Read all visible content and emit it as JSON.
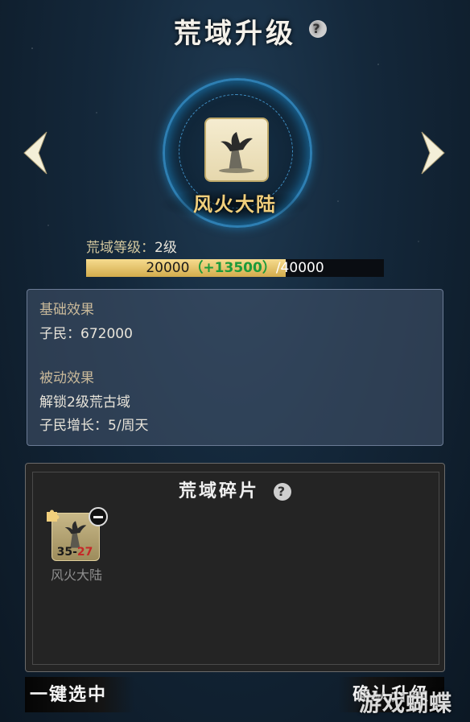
{
  "header": {
    "title": "荒域升级"
  },
  "domain": {
    "name": "风火大陆"
  },
  "level": {
    "label": "荒域等级：",
    "value": "2级"
  },
  "progress": {
    "current": "20000",
    "bonus": "（+13500）",
    "max": "/40000",
    "fill_fraction": 0.67
  },
  "effects": {
    "basic_title": "基础效果",
    "basic_lines": [
      "子民：672000"
    ],
    "passive_title": "被动效果",
    "passive_lines": [
      "解锁2级荒古域",
      "子民增长：5/周天"
    ]
  },
  "fragments": {
    "title": "荒域碎片",
    "items": [
      {
        "name": "风火大陆",
        "count_left": "35",
        "sep": "-",
        "count_right": "27"
      }
    ]
  },
  "buttons": {
    "select_all": "一键选中",
    "confirm": "确认升级"
  },
  "help_glyph": "?",
  "watermark": "游戏蝴蝶",
  "colors": {
    "accent_gold": "#f1cf7c",
    "bonus_green": "#1c9a3a",
    "ring_blue": "#2e7fb3"
  }
}
